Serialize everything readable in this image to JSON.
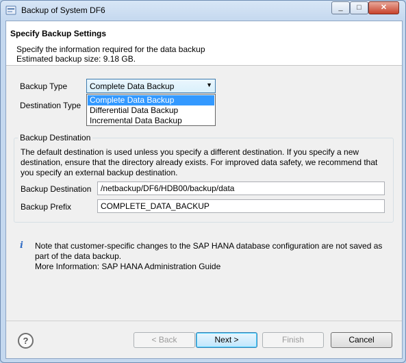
{
  "window": {
    "title": "Backup of System DF6",
    "controls": {
      "minimize": "_",
      "maximize": "□",
      "close": "✕"
    }
  },
  "header": {
    "title": "Specify Backup Settings",
    "line1": "Specify the information required for the data backup",
    "line2": "Estimated backup size: 9.18 GB."
  },
  "form": {
    "backup_type_label": "Backup Type",
    "backup_type_value": "Complete Data Backup",
    "backup_type_options": [
      "Complete Data Backup",
      "Differential Data Backup",
      "Incremental Data Backup"
    ],
    "destination_type_label": "Destination Type"
  },
  "destination": {
    "group_title": "Backup Destination",
    "description": "The default destination is used unless you specify a different destination. If you specify a new destination, ensure that the directory already exists. For improved data safety, we recommend that you specify an external backup destination.",
    "dest_label": "Backup Destination",
    "dest_value": "/netbackup/DF6/HDB00/backup/data",
    "prefix_label": "Backup Prefix",
    "prefix_value": "COMPLETE_DATA_BACKUP"
  },
  "info": {
    "icon": "i",
    "line1": "Note that customer-specific changes to the SAP HANA database configuration are not saved as part of the data backup.",
    "line2": "More Information: SAP HANA Administration Guide"
  },
  "footer": {
    "help": "?",
    "back": "< Back",
    "next": "Next >",
    "finish": "Finish",
    "cancel": "Cancel"
  }
}
